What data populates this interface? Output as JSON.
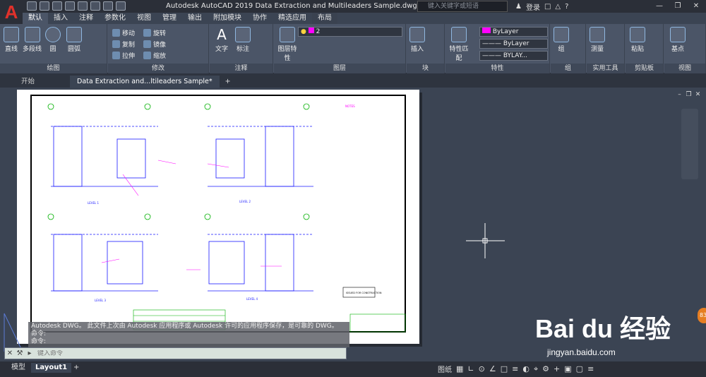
{
  "app": {
    "title": "Autodesk AutoCAD 2019    Data Extraction and Multileaders Sample.dwg",
    "search_placeholder": "键入关键字或短语",
    "login": "登录",
    "logo_letter": "A"
  },
  "ribbon_tabs": [
    "默认",
    "插入",
    "注释",
    "参数化",
    "视图",
    "管理",
    "输出",
    "附加模块",
    "协作",
    "精选应用",
    "布局"
  ],
  "active_tab": "默认",
  "draw_panel": {
    "label": "绘图",
    "tools": [
      "直线",
      "多段线",
      "圆",
      "圆弧"
    ]
  },
  "modify_panel": {
    "label": "修改",
    "tools": [
      "移动",
      "旋转",
      "复制",
      "镜像",
      "拉伸",
      "缩放"
    ]
  },
  "annotation_panel": {
    "label": "注释",
    "tools": [
      "文字",
      "标注"
    ]
  },
  "layers_panel": {
    "label": "图层",
    "tools": [
      "图层特性"
    ],
    "current_layer": "2"
  },
  "block_panel": {
    "label": "块",
    "tools": [
      "插入"
    ]
  },
  "properties_panel": {
    "label": "特性",
    "tools": [
      "特性匹配"
    ],
    "color": "ByLayer",
    "linetype": "ByLayer",
    "lineweight": "BYLAY..."
  },
  "groups_panel": {
    "label": "组",
    "tools": [
      "组"
    ]
  },
  "utilities_panel": {
    "label": "实用工具",
    "tools": [
      "测量"
    ]
  },
  "clipboard_panel": {
    "label": "剪贴板",
    "tools": [
      "粘贴"
    ]
  },
  "view_panel": {
    "label": "视图",
    "tools": [
      "基点"
    ]
  },
  "doc_tabs": [
    "开始",
    "Data Extraction and...ltileaders Sample*"
  ],
  "command": {
    "history": [
      "Autodesk DWG。  此文件上次由 Autodesk 应用程序或 Autodesk 许可的应用程序保存，是可靠的 DWG。",
      "命令:",
      "命令:"
    ],
    "placeholder": "键入命令"
  },
  "layout_tabs": [
    "模型",
    "Layout1"
  ],
  "active_layout": "Layout1",
  "status": {
    "paper_label": "图纸"
  },
  "watermark": {
    "brand": "Bai du 经验",
    "url": "jingyan.baidu.com",
    "badge": "83"
  },
  "drawing": {
    "notes_title": "NOTES",
    "stamp": "ISSUED FOR CONSTRUCTION",
    "level_labels": [
      "LEVEL 1",
      "LEVEL 2",
      "LEVEL 3",
      "LEVEL 4"
    ],
    "grid_bubbles": [
      "A",
      "B",
      "C",
      "D",
      "E",
      "F",
      "1",
      "2",
      "3"
    ]
  },
  "colors": {
    "accent": "#2b6cdf",
    "brand_red": "#e0312b",
    "magenta": "#ff00ff"
  }
}
